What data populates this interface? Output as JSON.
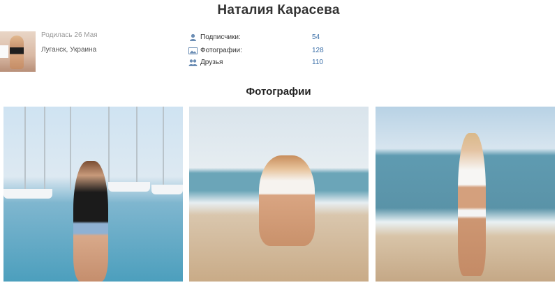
{
  "profile": {
    "name": "Наталия Карасева",
    "birthday": "Родилась 26 Мая",
    "location": "Луганск, Украина"
  },
  "stats": [
    {
      "icon": "user-icon",
      "label": "Подписчики:",
      "value": "54"
    },
    {
      "icon": "photo-icon",
      "label": "Фотографии:",
      "value": "128"
    },
    {
      "icon": "friends-icon",
      "label": "Друзья",
      "value": "110"
    }
  ],
  "photos": {
    "title": "Фотографии",
    "items": [
      {
        "icon": "photo-harbor-image"
      },
      {
        "icon": "photo-beach-sitting-image"
      },
      {
        "icon": "photo-beach-standing-image"
      }
    ]
  },
  "colors": {
    "link": "#3b6fa8",
    "text": "#333333",
    "muted": "#999999"
  }
}
